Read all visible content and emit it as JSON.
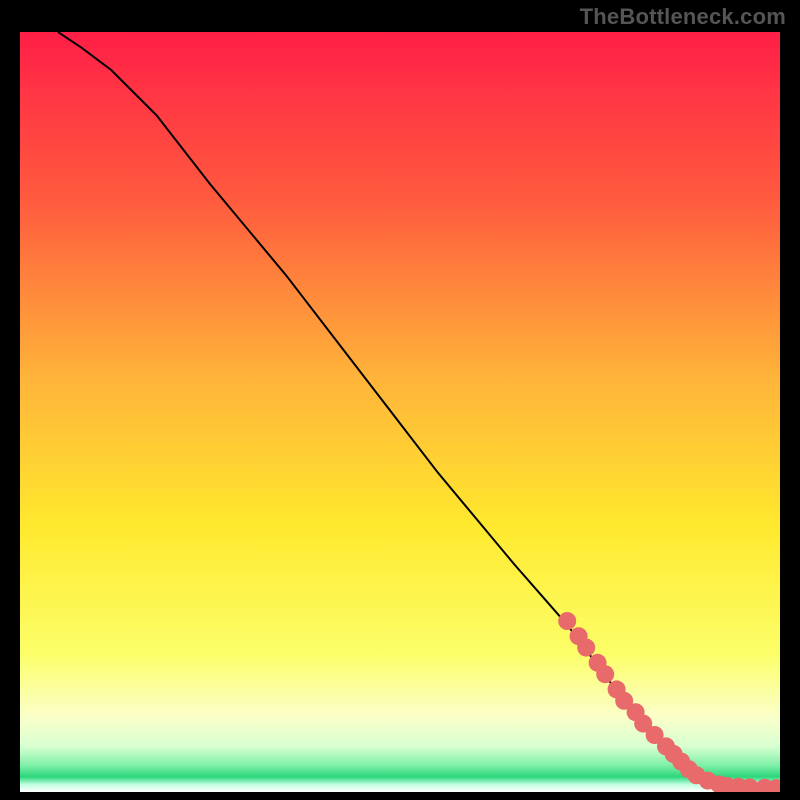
{
  "watermark": "TheBottleneck.com",
  "chart_data": {
    "type": "line",
    "title": "",
    "xlabel": "",
    "ylabel": "",
    "xlim": [
      0,
      100
    ],
    "ylim": [
      0,
      100
    ],
    "grid": false,
    "legend": false,
    "background_gradient": {
      "top_color": "#ff1f47",
      "mid_upper_color": "#ff813e",
      "mid_color": "#ffe92e",
      "lower_color": "#fbff9b",
      "base_band_color": "#2dd67c",
      "base_color": "#ffffff"
    },
    "series": [
      {
        "name": "curve",
        "type": "line",
        "color": "#000000",
        "x": [
          5,
          8,
          12,
          18,
          25,
          35,
          45,
          55,
          65,
          72,
          78,
          83,
          86,
          89,
          92,
          95,
          98,
          100
        ],
        "y": [
          100,
          98,
          95,
          89,
          80,
          68,
          55,
          42,
          30,
          22,
          14,
          8,
          5,
          2.5,
          1.2,
          0.6,
          0.4,
          0.3
        ]
      },
      {
        "name": "dots",
        "type": "scatter",
        "color": "#e86a6a",
        "radius": 9,
        "x": [
          72,
          73.5,
          74.5,
          76,
          77,
          78.5,
          79.5,
          81,
          82,
          83.5,
          85,
          86,
          87,
          88,
          89,
          90.5,
          92,
          93,
          94.5,
          96,
          98,
          99.5
        ],
        "y": [
          22.5,
          20.5,
          19,
          17,
          15.5,
          13.5,
          12,
          10.5,
          9,
          7.5,
          6,
          5,
          4,
          3,
          2.2,
          1.5,
          1,
          0.8,
          0.7,
          0.6,
          0.55,
          0.5
        ]
      }
    ]
  }
}
